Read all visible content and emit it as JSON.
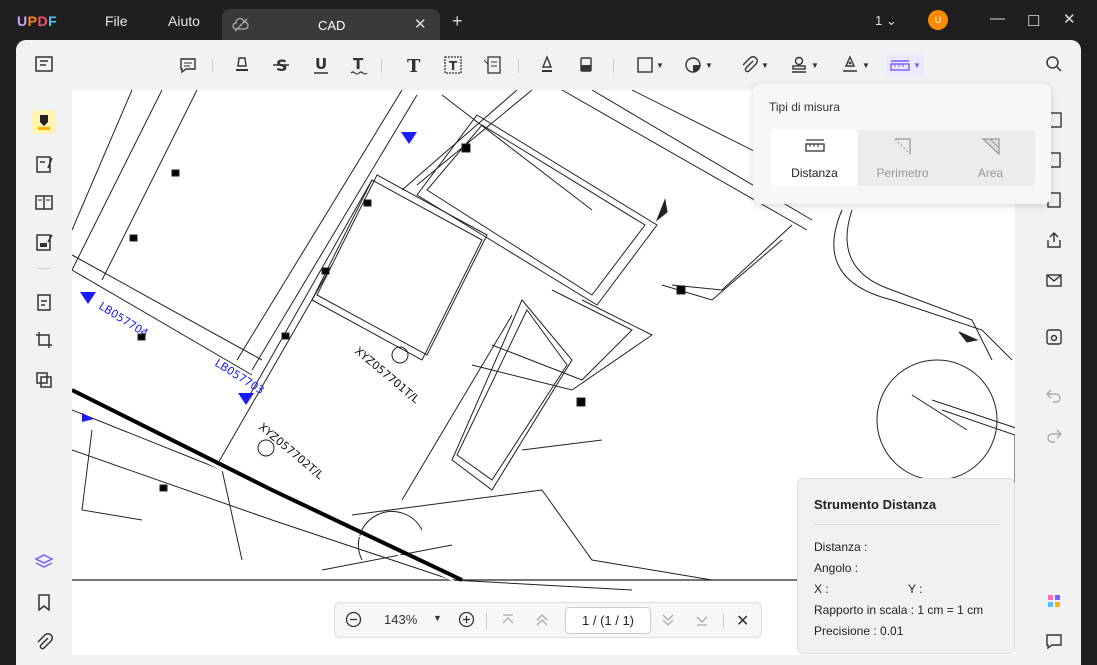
{
  "app": {
    "logo": "UPDF"
  },
  "menu": {
    "file": "File",
    "help": "Aiuto"
  },
  "tab": {
    "title": "CAD"
  },
  "titlebar": {
    "page_count": "1"
  },
  "user": {
    "avatar_initial": "U"
  },
  "measure_popup": {
    "title": "Tipi di misura",
    "options": [
      {
        "label": "Distanza",
        "selected": true
      },
      {
        "label": "Perimetro",
        "selected": false
      },
      {
        "label": "Area",
        "selected": false
      }
    ]
  },
  "distance_panel": {
    "title": "Strumento Distanza",
    "distance": "Distanza :",
    "angle": "Angolo :",
    "x": "X :",
    "y": "Y :",
    "scale": "Rapporto in scala : 1 cm = 1 cm",
    "precision": "Precisione : 0.01"
  },
  "zoom": {
    "level": "143%",
    "current_page": "1",
    "separator": "/",
    "page_total": "(1 / 1)"
  },
  "drawing_labels": {
    "lb1": "LB057704",
    "lb2": "LB057703",
    "xyz1": "XYZ057701T/L",
    "xyz2": "XYZ057702T/L"
  },
  "colors": {
    "accent": "#7b5cff",
    "marker_blue": "#1a1aff",
    "highlight": "#fff3b0"
  }
}
